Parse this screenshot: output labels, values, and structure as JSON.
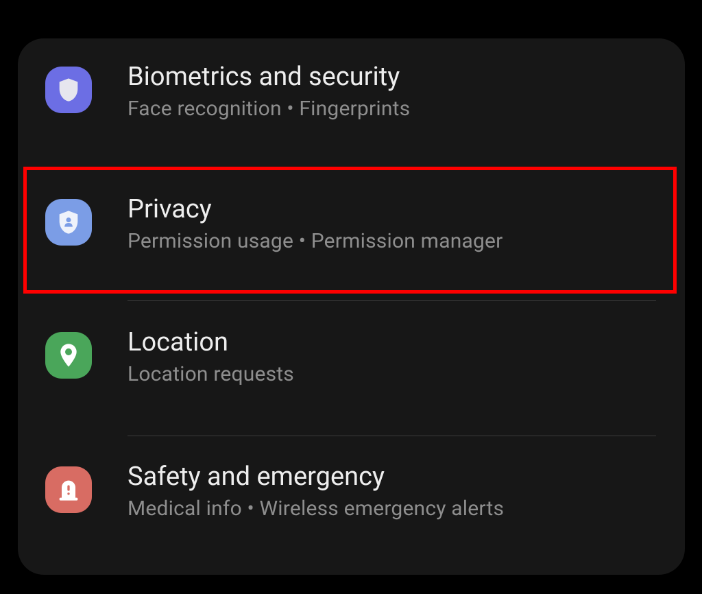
{
  "settings": {
    "items": [
      {
        "title": "Biometrics and security",
        "subtitle": "Face recognition  •  Fingerprints",
        "icon_name": "shield-icon",
        "icon_color": "#6c6ee4"
      },
      {
        "title": "Privacy",
        "subtitle": "Permission usage  •  Permission manager",
        "icon_name": "shield-person-icon",
        "icon_color": "#7b9de6"
      },
      {
        "title": "Location",
        "subtitle": "Location requests",
        "icon_name": "location-pin-icon",
        "icon_color": "#4aa65a"
      },
      {
        "title": "Safety and emergency",
        "subtitle": "Medical info  •  Wireless emergency alerts",
        "icon_name": "alert-siren-icon",
        "icon_color": "#d86c63"
      }
    ]
  },
  "highlight": {
    "item_index": 1,
    "color": "#ff0000"
  }
}
